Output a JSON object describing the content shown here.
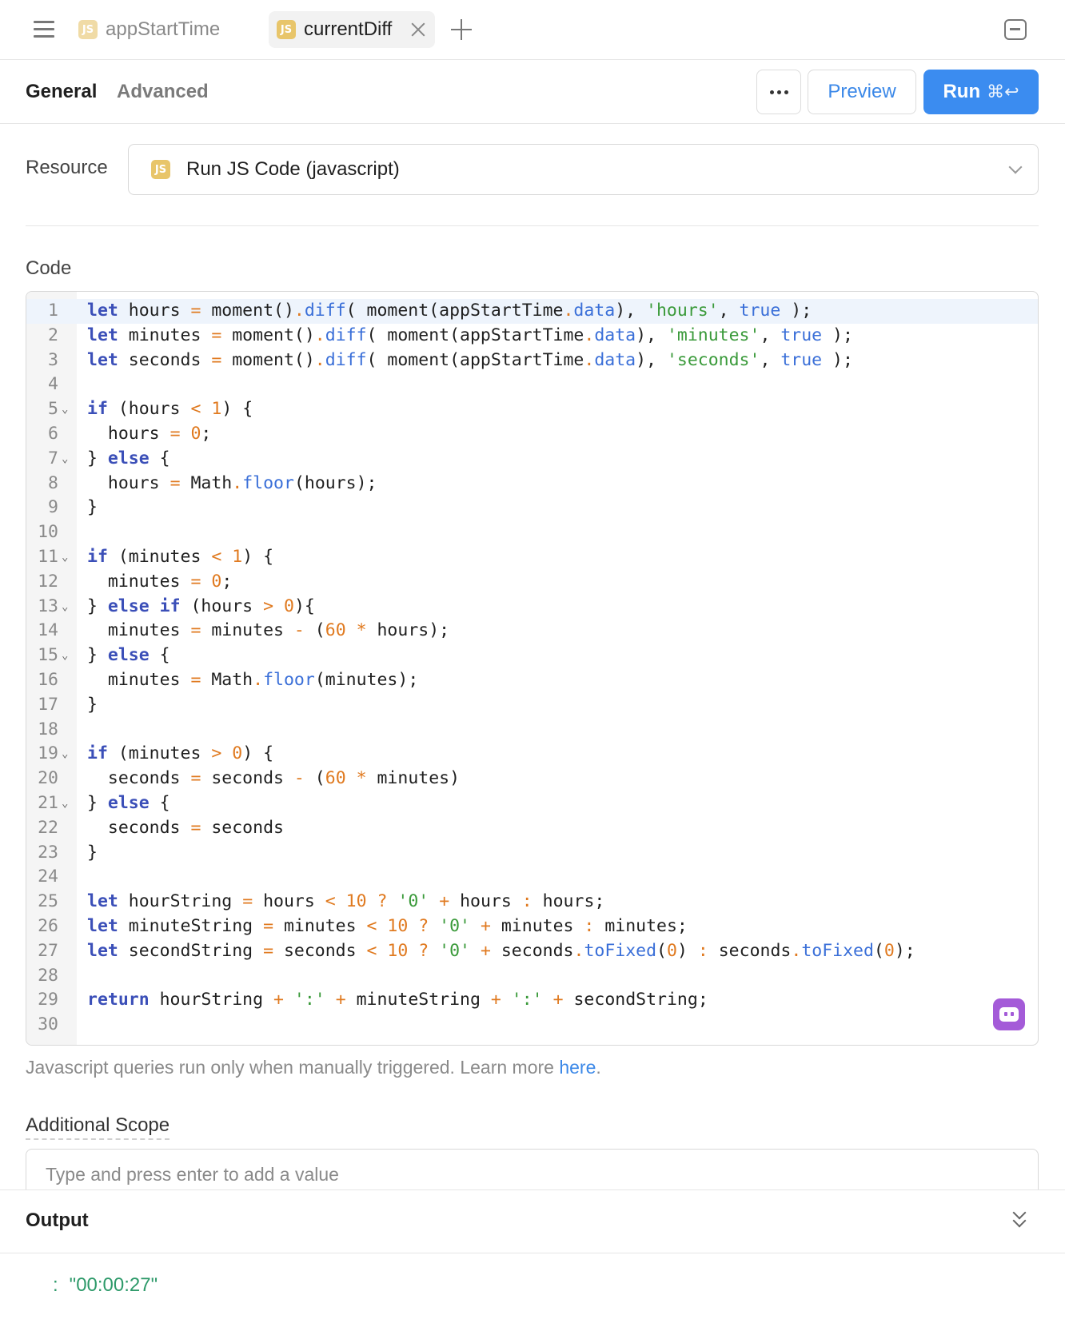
{
  "tabs": [
    {
      "label": "appStartTime",
      "badge": "JS",
      "active": false
    },
    {
      "label": "currentDiff",
      "badge": "JS",
      "active": true
    }
  ],
  "toolbar": {
    "general_label": "General",
    "advanced_label": "Advanced",
    "preview_label": "Preview",
    "run_label": "Run",
    "run_shortcut": "⌘↩"
  },
  "resource": {
    "label": "Resource",
    "badge": "JS",
    "value": "Run JS Code (javascript)"
  },
  "code": {
    "label": "Code",
    "active_line": 1,
    "lines": [
      "let hours = moment().diff( moment(appStartTime.data), 'hours', true );",
      "let minutes = moment().diff( moment(appStartTime.data), 'minutes', true );",
      "let seconds = moment().diff( moment(appStartTime.data), 'seconds', true );",
      "",
      "if (hours < 1) {",
      "  hours = 0;",
      "} else {",
      "  hours = Math.floor(hours);",
      "}",
      "",
      "if (minutes < 1) {",
      "  minutes = 0;",
      "} else if (hours > 0){",
      "  minutes = minutes - (60 * hours);",
      "} else {",
      "  minutes = Math.floor(minutes);",
      "}",
      "",
      "if (minutes > 0) {",
      "  seconds = seconds - (60 * minutes)",
      "} else {",
      "  seconds = seconds",
      "}",
      "",
      "let hourString = hours < 10 ? '0' + hours : hours;",
      "let minuteString = minutes < 10 ? '0' + minutes : minutes;",
      "let secondString = seconds < 10 ? '0' + seconds.toFixed(0) : seconds.toFixed(0);",
      "",
      "return hourString + ':' + minuteString + ':' + secondString;",
      ""
    ],
    "fold_lines": [
      5,
      7,
      11,
      13,
      15,
      19,
      21
    ]
  },
  "hint": {
    "text": "Javascript queries run only when manually triggered. Learn more ",
    "link": "here",
    "suffix": "."
  },
  "scope": {
    "label": "Additional Scope",
    "placeholder": "Type and press enter to add a value"
  },
  "output": {
    "title": "Output",
    "colon": ":",
    "value": "\"00:00:27\""
  }
}
